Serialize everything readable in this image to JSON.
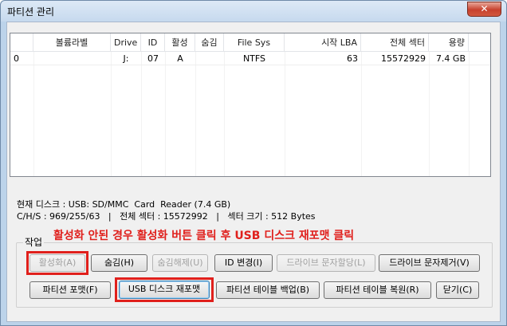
{
  "window": {
    "title": "파티션 관리",
    "close_label": "✕"
  },
  "table": {
    "columns": [
      "",
      "볼륨라벨",
      "Drive",
      "ID",
      "활성",
      "숨김",
      "File Sys",
      "시작 LBA",
      "전체 섹터",
      "용량"
    ],
    "rows": [
      [
        "0",
        "",
        "J:",
        "07",
        "A",
        "",
        "NTFS",
        "63",
        "15572929",
        "7.4 GB"
      ]
    ]
  },
  "info": {
    "line1": "현재 디스크 : USB: SD/MMC  Card  Reader (7.4 GB)",
    "line2": "C/H/S : 969/255/63   |   전체 섹터 : 15572992   |   섹터 크기 : 512 Bytes"
  },
  "group_label": "작업",
  "notice": "활성화 안된 경우 활성화 버튼 클릭 후 USB 디스크 재포맷 클릭",
  "buttons": {
    "activate": "활성화(A)",
    "hide": "숨김(H)",
    "unhide": "숨김해제(U)",
    "change_id": "ID 변경(I)",
    "assign_letter": "드라이브 문자할당(L)",
    "remove_letter": "드라이브 문자제거(V)",
    "format": "파티션 포맷(F)",
    "usb_reformat": "USB 디스크 재포맷",
    "backup_table": "파티션 테이블 백업(B)",
    "restore_table": "파티션 테이블 복원(R)",
    "close": "닫기(C)"
  },
  "colors": {
    "highlight": "#e0201c",
    "notice_text": "#e0201c"
  }
}
